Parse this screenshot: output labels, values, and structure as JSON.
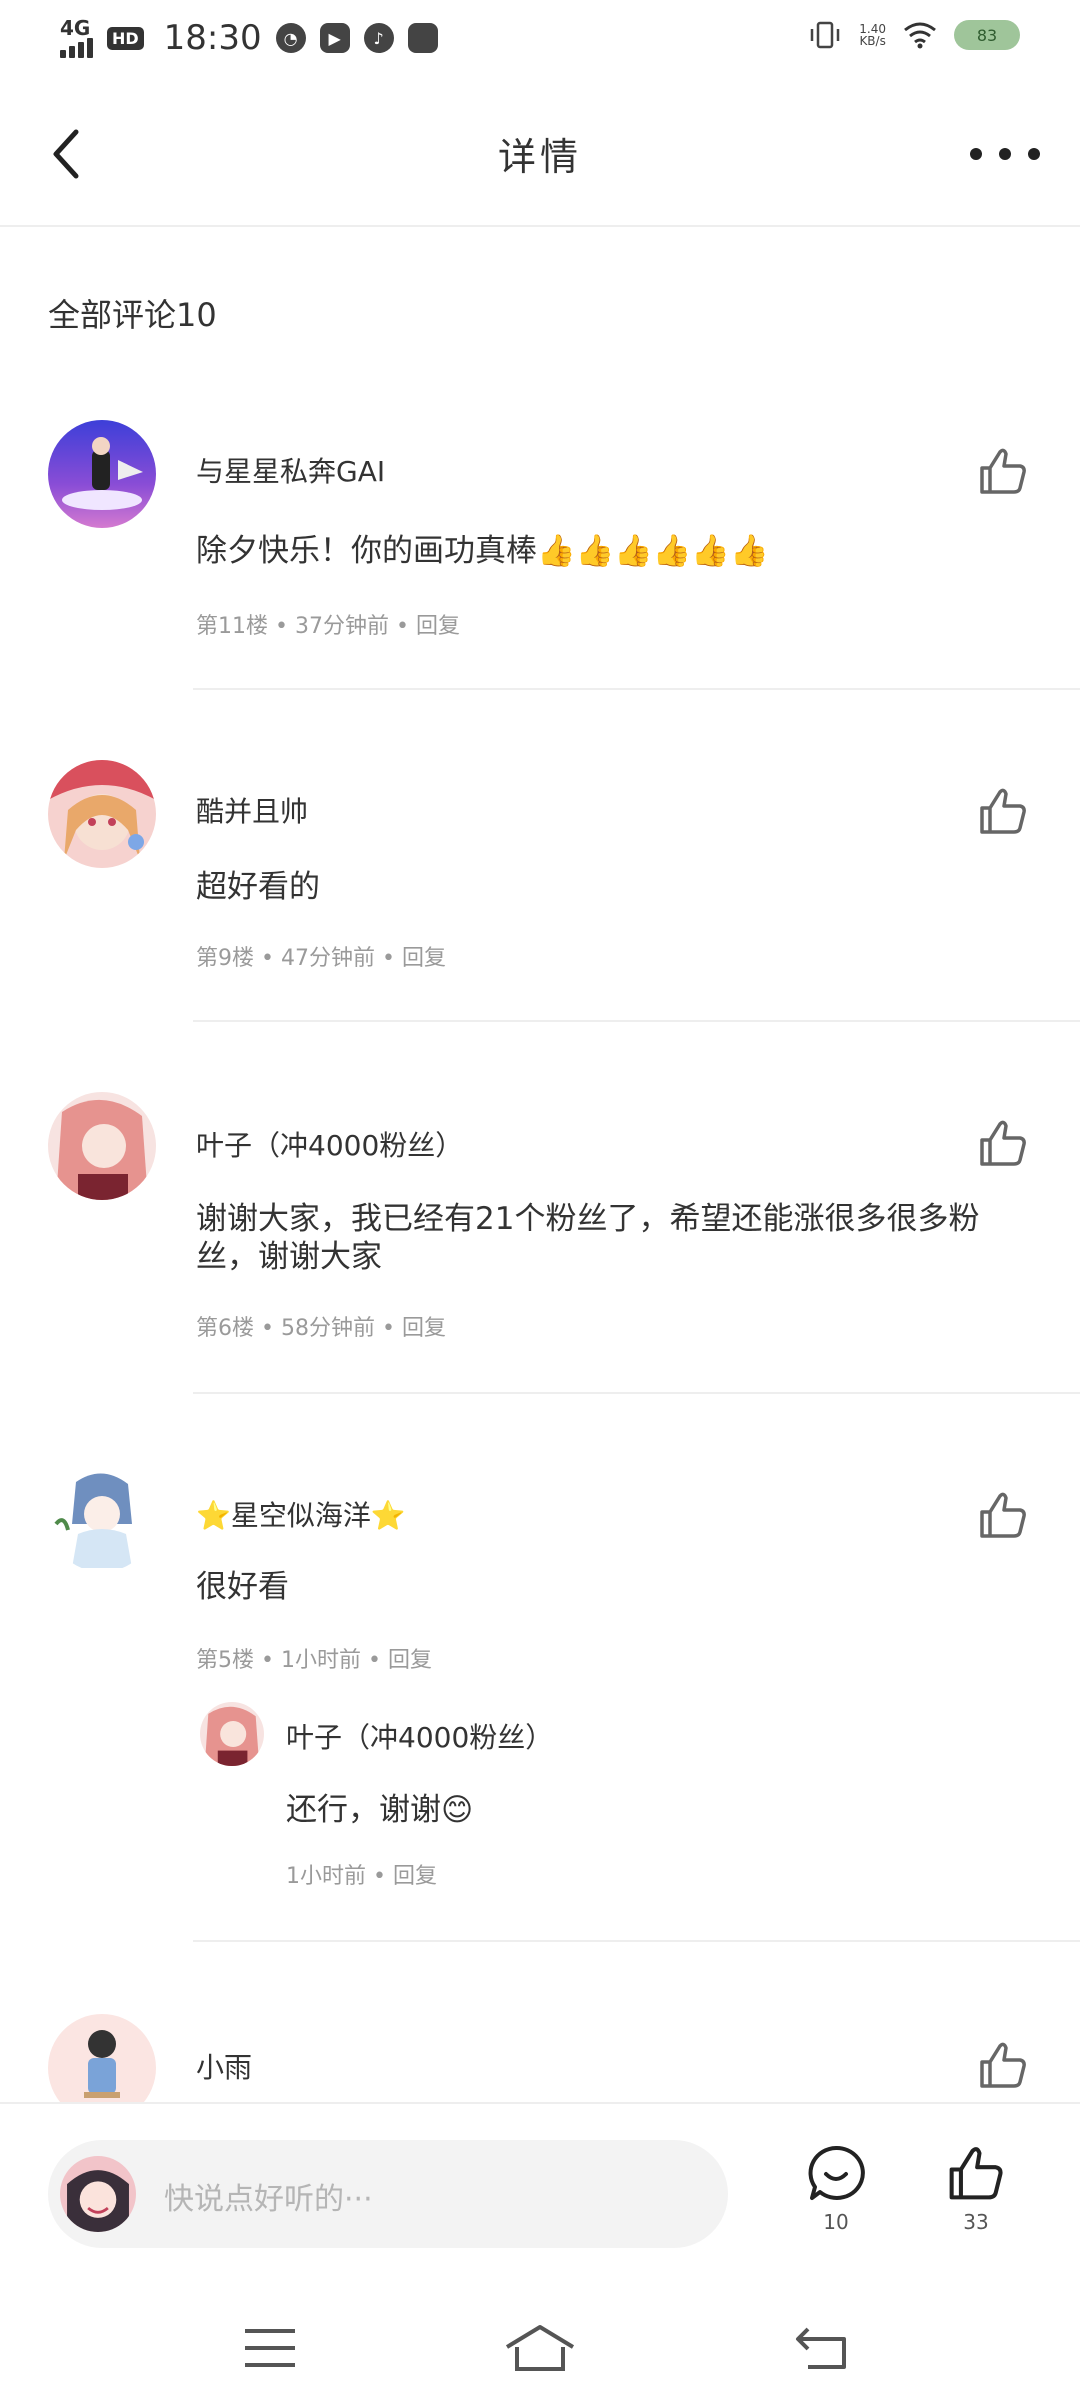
{
  "status_bar": {
    "network": "4G",
    "hd": "HD",
    "time": "18:30",
    "speed_value": "1.40",
    "speed_unit": "KB/s",
    "battery": "83"
  },
  "header": {
    "title": "详情"
  },
  "section": {
    "title": "全部评论10"
  },
  "comments": [
    {
      "name": "与星星私奔GAI",
      "text": "除夕快乐！你的画功真棒👍👍👍👍👍👍",
      "floor": "第11楼",
      "time": "37分钟前",
      "reply": "回复"
    },
    {
      "name": "酷并且帅",
      "text": "超好看的",
      "floor": "第9楼",
      "time": "47分钟前",
      "reply": "回复"
    },
    {
      "name": "叶子（冲4000粉丝）",
      "text": "谢谢大家，我已经有21个粉丝了，希望还能涨很多很多粉丝，谢谢大家",
      "floor": "第6楼",
      "time": "58分钟前",
      "reply": "回复"
    },
    {
      "name": "⭐星空似海洋⭐",
      "text": "很好看",
      "floor": "第5楼",
      "time": "1小时前",
      "reply": "回复",
      "sub_reply": {
        "name": "叶子（冲4000粉丝）",
        "text": "还行，谢谢😊",
        "time": "1小时前",
        "reply": "回复"
      }
    },
    {
      "name": "小雨"
    }
  ],
  "input": {
    "placeholder": "快说点好听的···"
  },
  "actions": {
    "comment_count": "10",
    "like_count": "33"
  },
  "icons": {
    "back": "back-arrow-icon",
    "more": "more-icon",
    "like": "thumbs-up-icon",
    "comment": "comment-bubble-icon",
    "menu": "menu-icon",
    "home": "home-icon",
    "return": "return-icon"
  },
  "colors": {
    "divider": "#eeeeee",
    "meta_text": "#9a9a9a",
    "placeholder": "#b5b5b5",
    "input_bg": "#f3f3f3"
  }
}
